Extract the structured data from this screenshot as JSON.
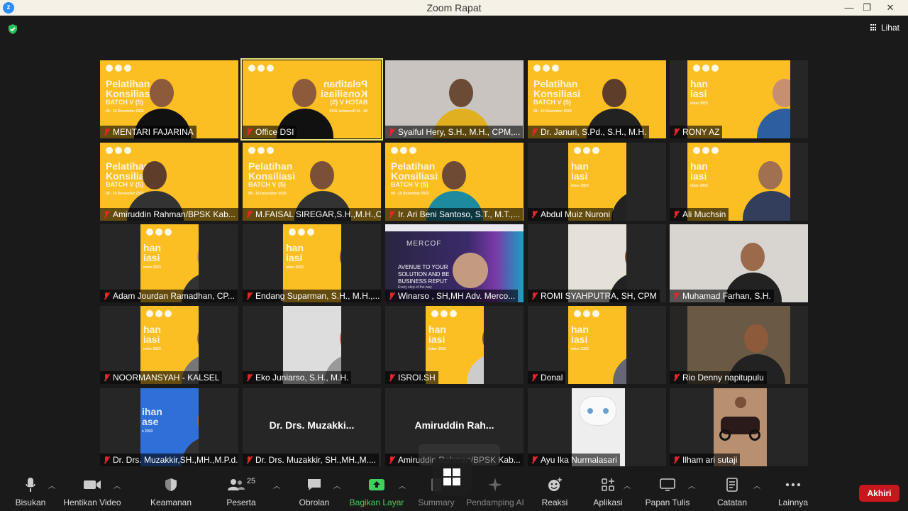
{
  "window": {
    "title": "Zoom Rapat",
    "minimize": "—",
    "restore": "❐",
    "close": "✕"
  },
  "view_button": {
    "label": "Lihat"
  },
  "tiles": [
    {
      "name": "MENTARI FAJARINA",
      "active": false
    },
    {
      "name": "Office DSI",
      "active": true
    },
    {
      "name": "Syaiful Hery, S.H., M.H., CPM,...",
      "active": false
    },
    {
      "name": "Dr. Januri, S.Pd., S.H., M.H.",
      "active": false
    },
    {
      "name": "RONY AZ",
      "active": false
    },
    {
      "name": "Amiruddin Rahman/BPSK Kab...",
      "active": false
    },
    {
      "name": "M.FAISAL SIREGAR,S.H.,M.H.,C...",
      "active": false
    },
    {
      "name": "Ir. Ari Beni Santoso, S.T., M.T.,...",
      "active": false
    },
    {
      "name": "Abdul Muiz Nuroni",
      "active": false
    },
    {
      "name": "Ali Muchsin",
      "active": false
    },
    {
      "name": "Adam Jourdan Ramadhan, CP...",
      "active": false
    },
    {
      "name": "Endang Suparman, S.H., M.H.,...",
      "active": false
    },
    {
      "name": "Winarso , SH,MH Adv. Merco...",
      "active": false
    },
    {
      "name": "ROMI SYAHPUTRA, SH, CPM",
      "active": false
    },
    {
      "name": "Muhamad Farhan, S.H.",
      "active": false
    },
    {
      "name": "NOORMANSYAH - KALSEL",
      "active": false
    },
    {
      "name": "Eko Juniarso, S.H., M.H.",
      "active": false
    },
    {
      "name": "ISROI.SH",
      "active": false
    },
    {
      "name": "Donal",
      "active": false
    },
    {
      "name": "Rio Denny napitupulu",
      "active": false
    },
    {
      "name": "Dr. Drs. Muzakkir,SH.,MH.,M.P.d.,...",
      "active": false
    },
    {
      "name": "Dr. Drs. Muzakkir, SH.,MH.,M....",
      "display_name": "Dr. Drs. Muzakki...",
      "active": false
    },
    {
      "name": "Amiruddin Rahman/BPSK Kab...",
      "display_name": "Amiruddin Rah...",
      "active": false
    },
    {
      "name": "Ayu Ika Nurmalasari",
      "active": false
    },
    {
      "name": "Ilham ari sutaji",
      "active": false
    }
  ],
  "banner_texts": {
    "pelatihan": "Pelatihan",
    "konsiliasi": "Konsiliasi",
    "batch": "BATCH V (5)",
    "date": "08 - 10 Desember 2023",
    "han": "han",
    "iasi": "iasi",
    "date_short": "mber 2023",
    "han_ilihan": "ihan",
    "ase": "ase",
    "year": "s 2023"
  },
  "shared_screen": {
    "brand": "MERCOF",
    "line1": "AVENUE TO YOUR",
    "line2": "SOLUTION AND BE",
    "line3": "BUSINESS REPUT",
    "line4": "Every step of the way"
  },
  "toolbar": {
    "mute": "Bisukan",
    "stop_video": "Hentikan Video",
    "security": "Keamanan",
    "participants": "Peserta",
    "participants_count": "25",
    "chat": "Obrolan",
    "share": "Bagikan Layar",
    "summary": "Summary",
    "ai": "Pendamping AI",
    "reactions": "Reaksi",
    "apps": "Aplikasi",
    "whiteboard": "Papan Tulis",
    "notes": "Catatan",
    "more": "Lainnya",
    "end": "Akhiri"
  },
  "colors": {
    "banner_yellow": "#fbbf24",
    "end_red": "#c8161d",
    "share_green": "#3fd15d",
    "active_outline": "#e8e37a"
  }
}
